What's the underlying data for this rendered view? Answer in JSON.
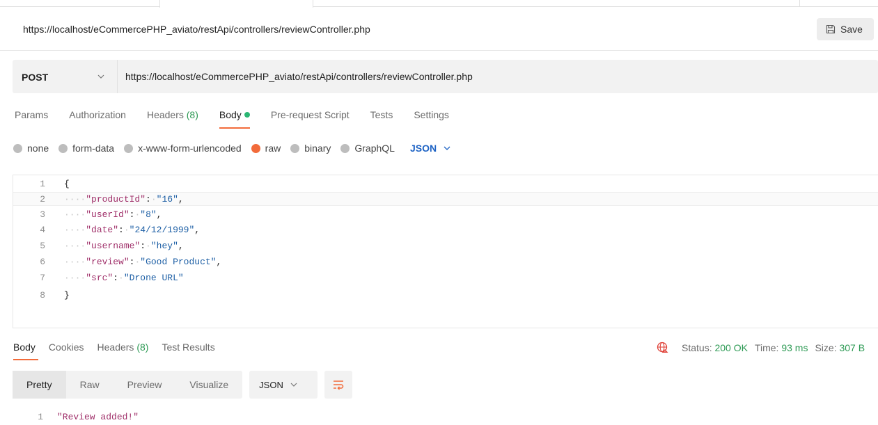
{
  "request": {
    "name": "https://localhost/eCommercePHP_aviato/restApi/controllers/reviewController.php",
    "save_label": "Save",
    "method": "POST",
    "url": "https://localhost/eCommercePHP_aviato/restApi/controllers/reviewController.php"
  },
  "request_tabs": {
    "params": "Params",
    "authorization": "Authorization",
    "headers": "Headers",
    "headers_count": "(8)",
    "body": "Body",
    "pre_request": "Pre-request Script",
    "tests": "Tests",
    "settings": "Settings"
  },
  "body_modes": {
    "none": "none",
    "form_data": "form-data",
    "urlencoded": "x-www-form-urlencoded",
    "raw": "raw",
    "binary": "binary",
    "graphql": "GraphQL",
    "format": "JSON",
    "selected": "raw"
  },
  "editor": {
    "line_numbers": [
      "1",
      "2",
      "3",
      "4",
      "5",
      "6",
      "7",
      "8"
    ],
    "open_brace": "{",
    "close_brace": "}",
    "fields": [
      {
        "key": "\"productId\"",
        "value": "\"16\"",
        "comma": ","
      },
      {
        "key": "\"userId\"",
        "value": "\"8\"",
        "comma": ","
      },
      {
        "key": "\"date\"",
        "value": "\"24/12/1999\"",
        "comma": ","
      },
      {
        "key": "\"username\"",
        "value": "\"hey\"",
        "comma": ","
      },
      {
        "key": "\"review\"",
        "value": "\"Good Product\"",
        "comma": ","
      },
      {
        "key": "\"src\"",
        "value": "\"Drone URL\"",
        "comma": ""
      }
    ]
  },
  "response_tabs": {
    "body": "Body",
    "cookies": "Cookies",
    "headers": "Headers",
    "headers_count": "(8)",
    "test_results": "Test Results"
  },
  "status": {
    "status_label": "Status:",
    "status_value": "200 OK",
    "time_label": "Time:",
    "time_value": "93 ms",
    "size_label": "Size:",
    "size_value": "307 B"
  },
  "response_view": {
    "pretty": "Pretty",
    "raw": "Raw",
    "preview": "Preview",
    "visualize": "Visualize",
    "format": "JSON",
    "line_number": "1",
    "body": "\"Review added!\""
  },
  "colors": {
    "accent": "#f26b3a",
    "success": "#2d9a54",
    "link_blue": "#1e63c4"
  }
}
